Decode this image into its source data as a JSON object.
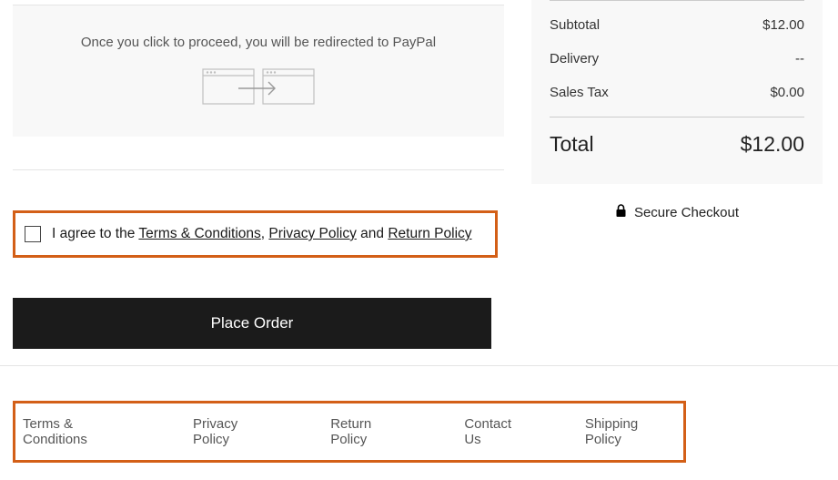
{
  "paypal": {
    "message": "Once you click to proceed, you will be redirected to PayPal"
  },
  "consent": {
    "prefix": "I agree to the ",
    "terms_label": "Terms & Conditions",
    "sep1": ", ",
    "privacy_label": "Privacy Policy",
    "sep2": " and ",
    "return_label": "Return Policy"
  },
  "place_order_label": "Place Order",
  "summary": {
    "subtotal_label": "Subtotal",
    "subtotal_value": "$12.00",
    "delivery_label": "Delivery",
    "delivery_value": "--",
    "tax_label": "Sales Tax",
    "tax_value": "$0.00",
    "total_label": "Total",
    "total_value": "$12.00"
  },
  "secure_label": "Secure Checkout",
  "footer": {
    "terms": "Terms & Conditions",
    "privacy": "Privacy Policy",
    "return": "Return Policy",
    "contact": "Contact Us",
    "shipping": "Shipping Policy"
  }
}
